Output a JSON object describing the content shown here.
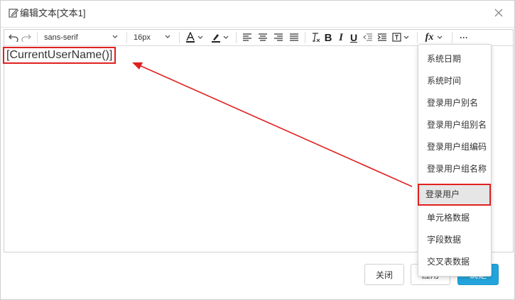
{
  "dialog": {
    "title": "编辑文本[文本1]",
    "close_icon": "close-icon"
  },
  "toolbar": {
    "undo_icon": "undo-icon",
    "redo_icon": "redo-icon",
    "font_family": "sans-serif",
    "font_size": "16px",
    "font_color_icon": "font-color-icon",
    "highlight_icon": "highlight-icon",
    "align_left_icon": "align-left-icon",
    "align_center_icon": "align-center-icon",
    "align_right_icon": "align-right-icon",
    "align_justify_icon": "align-justify-icon",
    "clear_format_icon": "clear-format-icon",
    "bold_label": "B",
    "italic_label": "I",
    "underline_label": "U",
    "outdent_icon": "outdent-icon",
    "indent_icon": "indent-icon",
    "insert_icon": "insert-icon",
    "fx_label": "fx",
    "more_label": "···"
  },
  "editor": {
    "content": "[CurrentUserName()]"
  },
  "fx_menu": {
    "items": [
      {
        "label": "系统日期",
        "active": false
      },
      {
        "label": "系统时间",
        "active": false
      },
      {
        "label": "登录用户别名",
        "active": false
      },
      {
        "label": "登录用户组别名",
        "active": false
      },
      {
        "label": "登录用户组编码",
        "active": false
      },
      {
        "label": "登录用户组名称",
        "active": false
      },
      {
        "label": "登录用户",
        "active": true
      },
      {
        "label": "单元格数据",
        "active": false
      },
      {
        "label": "字段数据",
        "active": false
      },
      {
        "label": "交叉表数据",
        "active": false
      }
    ]
  },
  "footer": {
    "close_label": "关闭",
    "apply_label": "应用",
    "ok_label": "确定"
  },
  "colors": {
    "annotation_red": "#e02020",
    "primary_blue": "#23a5dc"
  }
}
